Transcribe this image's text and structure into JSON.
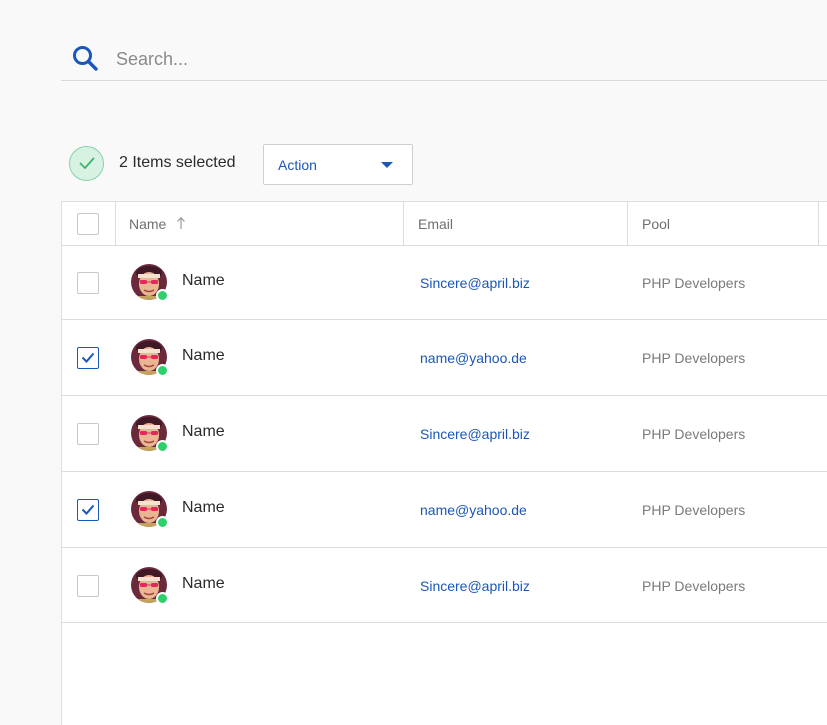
{
  "search": {
    "placeholder": "Search...",
    "value": ""
  },
  "selection": {
    "text": "2 Items selected",
    "action_label": "Action"
  },
  "table": {
    "columns": {
      "name": "Name",
      "email": "Email",
      "pool": "Pool"
    },
    "sort": {
      "column": "Name",
      "direction": "ascending",
      "icon": "arrow-up-icon"
    },
    "rows": [
      {
        "name": "Name",
        "email": "Sincere@april.biz",
        "pool": "PHP Developers",
        "checked": false,
        "status": "online"
      },
      {
        "name": "Name",
        "email": "name@yahoo.de",
        "pool": "PHP Developers",
        "checked": true,
        "status": "online"
      },
      {
        "name": "Name",
        "email": "Sincere@april.biz",
        "pool": "PHP Developers",
        "checked": false,
        "status": "online"
      },
      {
        "name": "Name",
        "email": "name@yahoo.de",
        "pool": "PHP Developers",
        "checked": true,
        "status": "online"
      },
      {
        "name": "Name",
        "email": "Sincere@april.biz",
        "pool": "PHP Developers",
        "checked": false,
        "status": "online"
      }
    ]
  },
  "colors": {
    "accent": "#1a57b8",
    "online": "#2fcf6c",
    "selected_badge_bg": "#d7f2e2",
    "selected_badge_check": "#3bb56c"
  }
}
